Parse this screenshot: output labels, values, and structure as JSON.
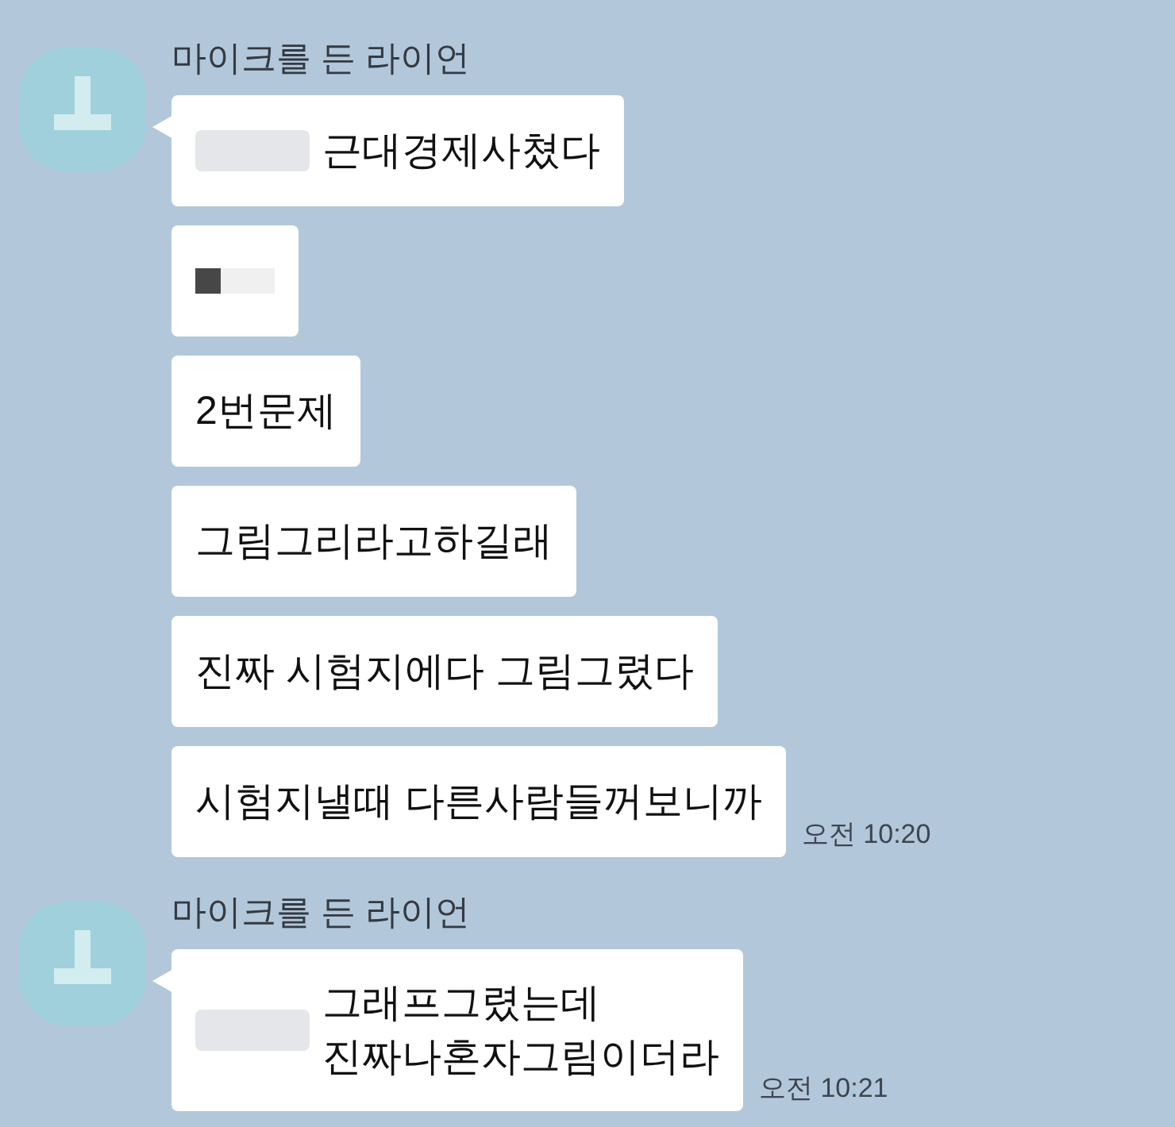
{
  "groups": [
    {
      "sender": "마이크를 든 라이언",
      "messages": [
        {
          "kind": "text",
          "redacted_prefix": true,
          "lines": [
            "근대경제사쳤다"
          ]
        },
        {
          "kind": "redacted-image"
        },
        {
          "kind": "text",
          "redacted_prefix": false,
          "lines": [
            "2번문제"
          ]
        },
        {
          "kind": "text",
          "redacted_prefix": false,
          "lines": [
            "그림그리라고하길래"
          ]
        },
        {
          "kind": "text",
          "redacted_prefix": false,
          "lines": [
            "진짜 시험지에다 그림그렸다"
          ]
        },
        {
          "kind": "text",
          "redacted_prefix": false,
          "lines": [
            "시험지낼때 다른사람들꺼보니까"
          ],
          "time": "오전 10:20"
        }
      ]
    },
    {
      "sender": "마이크를 든 라이언",
      "messages": [
        {
          "kind": "text",
          "redacted_prefix": true,
          "lines": [
            "그래프그렸는데",
            "진짜나혼자그림이더라"
          ],
          "time": "오전 10:21"
        }
      ]
    }
  ]
}
